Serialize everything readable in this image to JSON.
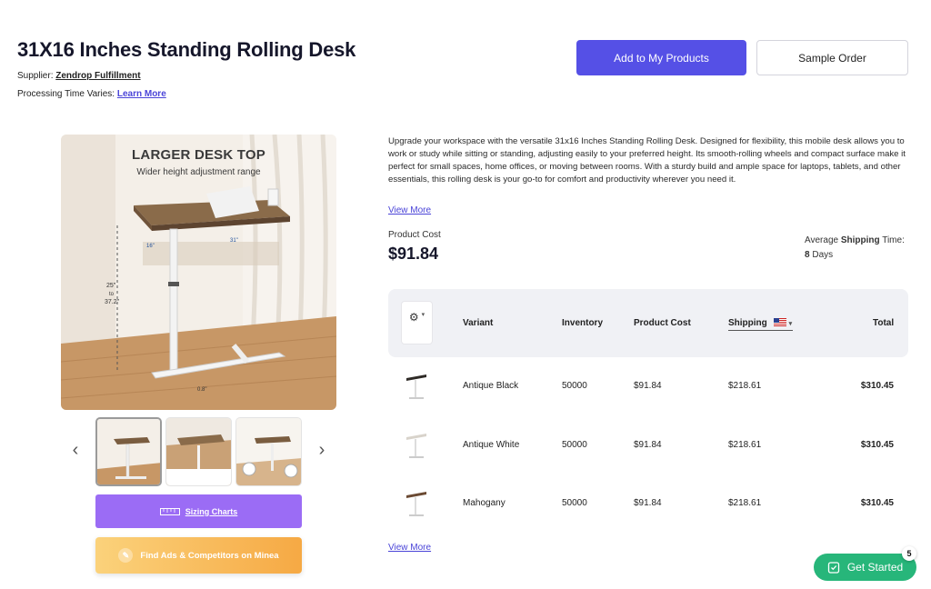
{
  "product": {
    "title": "31X16 Inches Standing Rolling Desk",
    "supplier_prefix": "Supplier: ",
    "supplier_name": "Zendrop Fulfillment",
    "processing_prefix": "Processing Time Varies: ",
    "learn_more": "Learn More"
  },
  "actions": {
    "add_label": "Add to My Products",
    "sample_label": "Sample Order"
  },
  "gallery": {
    "main_heading": "LARGER DESK TOP",
    "main_subheading": "Wider height adjustment range",
    "dims": {
      "width": "31\"",
      "depth": "16\"",
      "h1": "25\"",
      "to": "to",
      "h2": "37.2\"",
      "base": "0.8\""
    },
    "prev_icon": "chevron-left-icon",
    "next_icon": "chevron-right-icon"
  },
  "tools": {
    "sizing_label": "Sizing Charts",
    "minea_label": "Find Ads & Competitors on Minea"
  },
  "description": {
    "text": "Upgrade your workspace with the versatile 31x16 Inches Standing Rolling Desk. Designed for flexibility, this mobile desk allows you to work or study while sitting or standing, adjusting easily to your preferred height. Its smooth-rolling wheels and compact surface make it perfect for small spaces, home offices, or moving between rooms. With a sturdy build and ample space for laptops, tablets, and other essentials, this rolling desk is your go-to for comfort and productivity wherever you need it.",
    "view_more": "View More"
  },
  "pricing": {
    "cost_label": "Product Cost",
    "cost_value": "$91.84",
    "avg_prefix": "Average ",
    "avg_bold": "Shipping",
    "avg_suffix": " Time:",
    "days_value": "8",
    "days_unit": " Days"
  },
  "table": {
    "headers": {
      "variant": "Variant",
      "inventory": "Inventory",
      "cost": "Product Cost",
      "shipping": "Shipping",
      "total": "Total"
    },
    "rows": [
      {
        "variant": "Antique Black",
        "inventory": "50000",
        "cost": "$91.84",
        "shipping": "$218.61",
        "total": "$310.45",
        "top_color": "#2e2a26"
      },
      {
        "variant": "Antique White",
        "inventory": "50000",
        "cost": "$91.84",
        "shipping": "$218.61",
        "total": "$310.45",
        "top_color": "#e8e4dd"
      },
      {
        "variant": "Mahogany",
        "inventory": "50000",
        "cost": "$91.84",
        "shipping": "$218.61",
        "total": "$310.45",
        "top_color": "#6b4a33"
      }
    ],
    "view_more": "View More"
  },
  "widget": {
    "label": "Get Started",
    "badge": "5"
  },
  "colors": {
    "primary": "#5550e6",
    "sizing": "#9b6cf5",
    "success": "#27b67a"
  }
}
